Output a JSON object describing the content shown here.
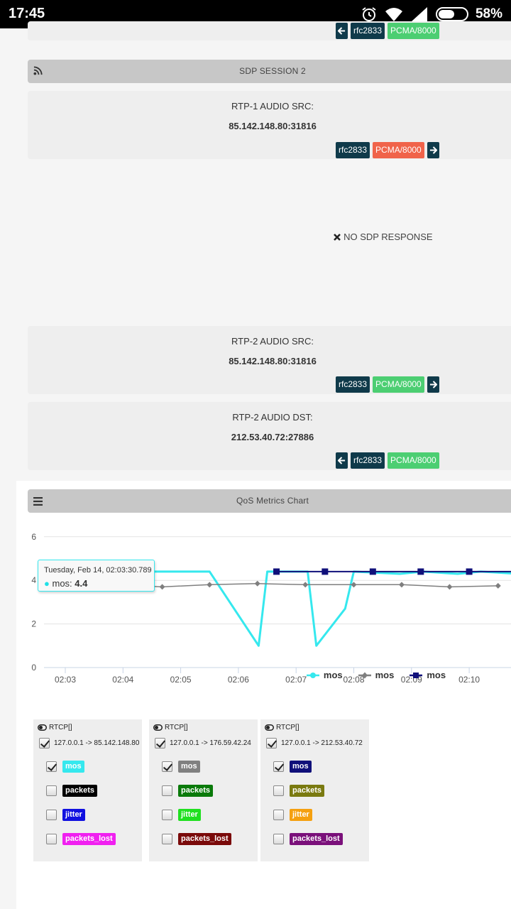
{
  "status_bar": {
    "time": "17:45",
    "battery": "58%",
    "battery_level": 0.58
  },
  "top_card": {
    "badges": [
      "rfc2833",
      "PCMA/8000"
    ]
  },
  "sdp_session": {
    "title": "SDP SESSION 2"
  },
  "cards": [
    {
      "label": "RTP-1 AUDIO SRC:",
      "address": "85.142.148.80:31816",
      "badges": [
        "rfc2833",
        "PCMA/8000"
      ]
    },
    {
      "label": "RTP-2 AUDIO SRC:",
      "address": "85.142.148.80:31816",
      "badges": [
        "rfc2833",
        "PCMA/8000"
      ]
    },
    {
      "label": "RTP-2 AUDIO DST:",
      "address": "212.53.40.72:27886",
      "badges": [
        "rfc2833",
        "PCMA/8000"
      ]
    }
  ],
  "no_sdp": "NO SDP RESPONSE",
  "qos": {
    "title": "QoS Metrics Chart"
  },
  "colors": {
    "cyan": "#35e8ee",
    "gray": "#7f7f7f",
    "navy": "#10107a",
    "badge_dark": "#0f3a4a",
    "badge_green": "#4cce72",
    "badge_red": "#f0634a"
  },
  "chart_data": {
    "type": "line",
    "x_ticks": [
      "02:03",
      "02:04",
      "02:05",
      "02:06",
      "02:07",
      "02:08",
      "02:09",
      "02:10"
    ],
    "y_ticks": [
      "0",
      "2",
      "4",
      "6"
    ],
    "ylim": [
      0,
      6
    ],
    "xlim": [
      -0.16,
      7.85
    ],
    "series": [
      {
        "name": "mos",
        "color": "#35e8ee",
        "marker": "circle",
        "points": [
          [
            -0.16,
            4.4
          ],
          [
            0.5,
            4.4
          ],
          [
            1.0,
            4.4
          ],
          [
            1.5,
            4.4
          ],
          [
            2.5,
            4.4
          ],
          [
            3.35,
            1.0
          ],
          [
            3.5,
            4.4
          ],
          [
            4.2,
            4.4
          ],
          [
            4.35,
            1.0
          ],
          [
            4.85,
            2.7
          ],
          [
            5.0,
            4.4
          ],
          [
            5.8,
            4.3
          ],
          [
            6.2,
            4.4
          ],
          [
            6.8,
            4.3
          ],
          [
            7.2,
            4.4
          ],
          [
            7.85,
            4.3
          ]
        ]
      },
      {
        "name": "mos",
        "color": "#7f7f7f",
        "marker": "diamond",
        "points": [
          [
            0,
            3.8
          ],
          [
            0.85,
            3.8
          ],
          [
            1.68,
            3.7
          ],
          [
            2.5,
            3.8
          ],
          [
            3.33,
            3.85
          ],
          [
            4.16,
            3.8
          ],
          [
            5.0,
            3.8
          ],
          [
            5.83,
            3.8
          ],
          [
            6.66,
            3.7
          ],
          [
            7.5,
            3.75
          ]
        ]
      },
      {
        "name": "mos",
        "color": "#10107a",
        "marker": "square",
        "points": [
          [
            3.66,
            4.4
          ],
          [
            4.5,
            4.4
          ],
          [
            5.33,
            4.4
          ],
          [
            6.16,
            4.4
          ],
          [
            7.0,
            4.4
          ],
          [
            7.85,
            4.4
          ]
        ]
      }
    ],
    "tooltip": {
      "date": "Tuesday, Feb 14, 02:03:30.789",
      "series": "mos",
      "value": "4.4",
      "x": 0.5,
      "y": 4.4
    },
    "legend": [
      "mos",
      "mos",
      "mos"
    ],
    "grid": true,
    "legend_position": "bottom"
  },
  "rtcp_panels": [
    {
      "header": "RTCP[]",
      "connection": "127.0.0.1 -> 85.142.148.80",
      "metrics": [
        {
          "label": "mos",
          "checked": true,
          "bg": "#35e8ee",
          "fg": "#ffffff"
        },
        {
          "label": "packets",
          "checked": false,
          "bg": "#000000",
          "fg": "#ffffff"
        },
        {
          "label": "jitter",
          "checked": false,
          "bg": "#1010e0",
          "fg": "#ffffff"
        },
        {
          "label": "packets_lost",
          "checked": false,
          "bg": "#f020f0",
          "fg": "#ffffff"
        }
      ]
    },
    {
      "header": "RTCP[]",
      "connection": "127.0.0.1 -> 176.59.42.24",
      "metrics": [
        {
          "label": "mos",
          "checked": true,
          "bg": "#808080",
          "fg": "#ffffff"
        },
        {
          "label": "packets",
          "checked": false,
          "bg": "#0a7a0a",
          "fg": "#ffffff"
        },
        {
          "label": "jitter",
          "checked": false,
          "bg": "#20e020",
          "fg": "#ffffff"
        },
        {
          "label": "packets_lost",
          "checked": false,
          "bg": "#7a0a0a",
          "fg": "#ffffff"
        }
      ]
    },
    {
      "header": "RTCP[]",
      "connection": "127.0.0.1 -> 212.53.40.72",
      "metrics": [
        {
          "label": "mos",
          "checked": true,
          "bg": "#10107a",
          "fg": "#ffffff"
        },
        {
          "label": "packets",
          "checked": false,
          "bg": "#7a7a10",
          "fg": "#ffffff"
        },
        {
          "label": "jitter",
          "checked": false,
          "bg": "#f5a010",
          "fg": "#ffffff"
        },
        {
          "label": "packets_lost",
          "checked": false,
          "bg": "#7a107a",
          "fg": "#ffffff"
        }
      ]
    }
  ]
}
